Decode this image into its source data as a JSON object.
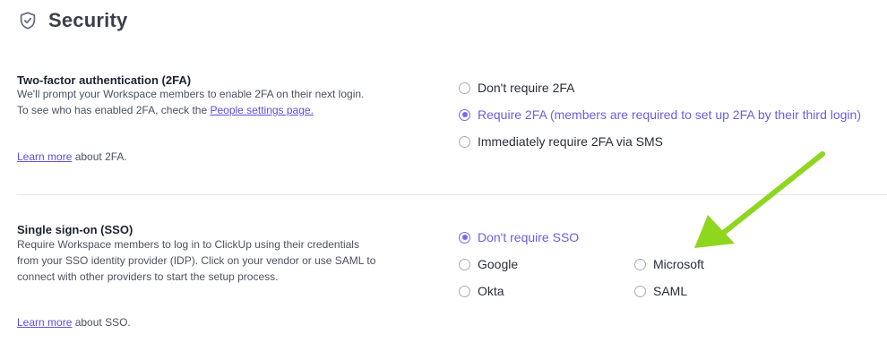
{
  "header": {
    "title": "Security",
    "icon": "shield-check-icon"
  },
  "twofa": {
    "title": "Two-factor authentication (2FA)",
    "desc_line1": "We'll prompt your Workspace members to enable 2FA on their next login.",
    "desc_line2_prefix": "To see who has enabled 2FA, check the ",
    "people_link": "People settings page.",
    "learn_link": "Learn more",
    "learn_suffix": " about 2FA.",
    "options": [
      {
        "label": "Don't require 2FA",
        "selected": false
      },
      {
        "label": "Require 2FA (members are required to set up 2FA by their third login)",
        "selected": true
      },
      {
        "label": "Immediately require 2FA via SMS",
        "selected": false
      }
    ]
  },
  "sso": {
    "title": "Single sign-on (SSO)",
    "desc_line1": "Require Workspace members to log in to ClickUp using their credentials",
    "desc_line2": "from your SSO identity provider (IDP). Click on your vendor or use SAML to",
    "desc_line3": "connect with other providers to start the setup process.",
    "learn_link": "Learn more",
    "learn_suffix": " about SSO.",
    "options": [
      {
        "label": "Don't require SSO",
        "selected": true
      },
      {
        "label": "Google",
        "selected": false
      },
      {
        "label": "Microsoft",
        "selected": false
      },
      {
        "label": "Okta",
        "selected": false
      },
      {
        "label": "SAML",
        "selected": false
      }
    ]
  },
  "colors": {
    "accent": "#7b68ee",
    "link": "#5b4fe0",
    "annotation_arrow": "#8fd61f"
  }
}
